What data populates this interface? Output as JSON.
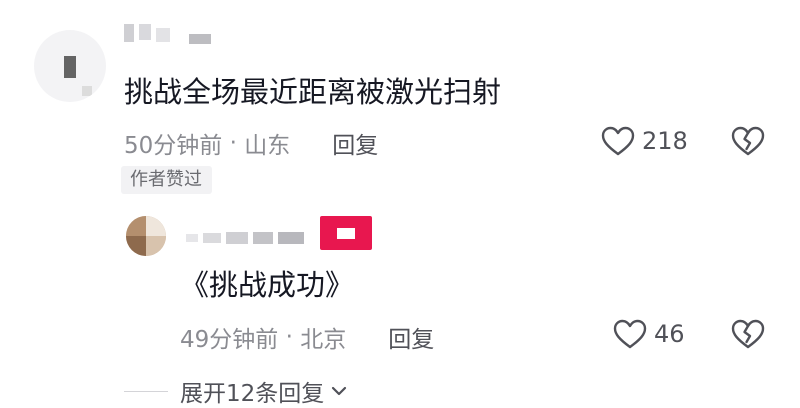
{
  "comment": {
    "text": "挑战全场最近距离被激光扫射",
    "time": "50分钟前",
    "location": "山东",
    "reply_label": "回复",
    "likes": "218",
    "author_liked": "作者赞过"
  },
  "reply": {
    "text": "《挑战成功》",
    "time": "49分钟前",
    "location": "北京",
    "reply_label": "回复",
    "likes": "46"
  },
  "expand_label": "展开12条回复",
  "colors": {
    "badge": "#e8174f",
    "text": "#161823",
    "meta": "#8a8b91",
    "tag_bg": "#f2f2f4"
  },
  "icons": {
    "like": "heart-outline-icon",
    "dislike": "broken-heart-icon",
    "expand": "chevron-down-icon"
  }
}
